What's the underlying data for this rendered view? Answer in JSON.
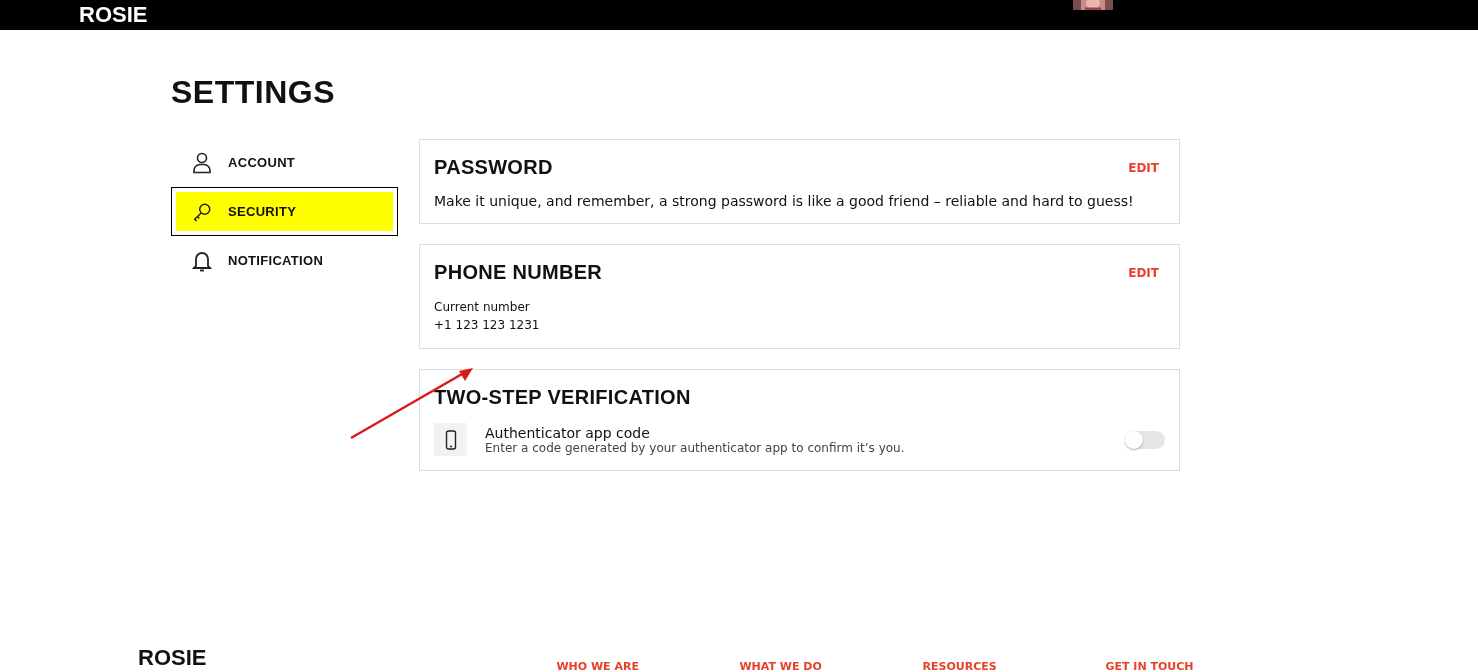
{
  "header": {
    "logo": "ROSIE"
  },
  "page_title": "SETTINGS",
  "sidebar": {
    "items": [
      {
        "label": "ACCOUNT",
        "selected": false
      },
      {
        "label": "SECURITY",
        "selected": true
      },
      {
        "label": "NOTIFICATION",
        "selected": false
      }
    ]
  },
  "sections": [
    {
      "kind": "text",
      "title": "PASSWORD",
      "action": "EDIT",
      "text": "Make it unique, and remember, a strong password is like a good friend – reliable and hard to guess!"
    },
    {
      "kind": "value",
      "title": "PHONE NUMBER",
      "action": "EDIT",
      "label": "Current number",
      "value": "+1 123 123 1231"
    },
    {
      "kind": "toggle",
      "title": "TWO-STEP VERIFICATION",
      "option": {
        "title": "Authenticator app code",
        "description": "Enter a code generated by your authenticator app to confirm it’s you.",
        "on": false
      }
    }
  ],
  "footer": {
    "logo": "ROSIE",
    "links": [
      "WHO WE ARE",
      "WHAT WE DO",
      "RESOURCES",
      "GET IN TOUCH"
    ]
  }
}
